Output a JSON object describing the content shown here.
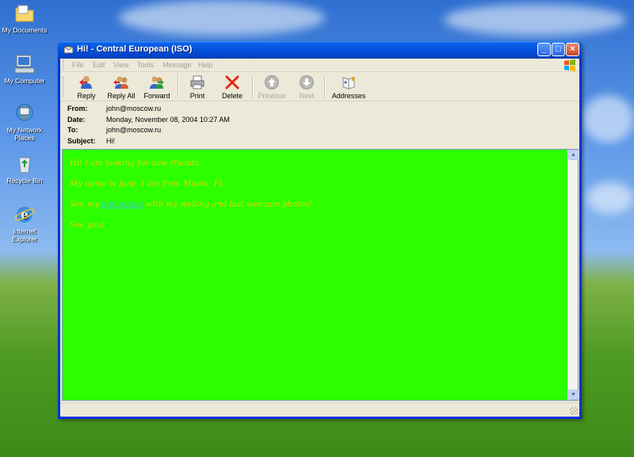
{
  "desktop": {
    "icons": [
      {
        "label_line1": "My Documents",
        "label_line2": ""
      },
      {
        "label_line1": "My Computer",
        "label_line2": ""
      },
      {
        "label_line1": "My Network",
        "label_line2": "Places"
      },
      {
        "label_line1": "Recycle Bin",
        "label_line2": ""
      },
      {
        "label_line1": "Internet",
        "label_line2": "Explorer"
      }
    ]
  },
  "window": {
    "title": "Hi! - Central European (ISO)",
    "controls": {
      "minimize": "_",
      "maximize": "□",
      "close": "×"
    }
  },
  "menu": [
    "File",
    "Edit",
    "View",
    "Tools",
    "Message",
    "Help"
  ],
  "toolbar": {
    "reply": "Reply",
    "reply_all": "Reply All",
    "forward": "Forward",
    "print": "Print",
    "delete": "Delete",
    "previous": "Previous",
    "next": "Next",
    "addresses": "Addresses"
  },
  "headers": {
    "from_label": "From:",
    "from_value": "john@moscow.ru",
    "date_label": "Date:",
    "date_value": "Monday, November 08, 2004 10:27 AM",
    "to_label": "To:",
    "to_value": "john@moscow.ru",
    "subject_label": "Subject:",
    "subject_value": "Hi!"
  },
  "message": {
    "line1": "Hi! I am looking for new friends.",
    "line2": "My name is Jane, I am from Miami, FL.",
    "line3_pre": "See my ",
    "line3_link": "homepage",
    "line3_post": " with my weblog and last webcam photos!",
    "line4": "See you!"
  },
  "colors": {
    "message_background": "#2bff00",
    "message_text": "#dcd800",
    "link": "#3ac4d8",
    "titlebar": "#0453de"
  },
  "icons": {
    "reply": "reply-icon",
    "reply_all": "reply-all-icon",
    "forward": "forward-icon",
    "print": "printer-icon",
    "delete": "delete-x-icon",
    "previous": "up-arrow-icon",
    "next": "down-arrow-icon",
    "addresses": "address-book-icon"
  }
}
